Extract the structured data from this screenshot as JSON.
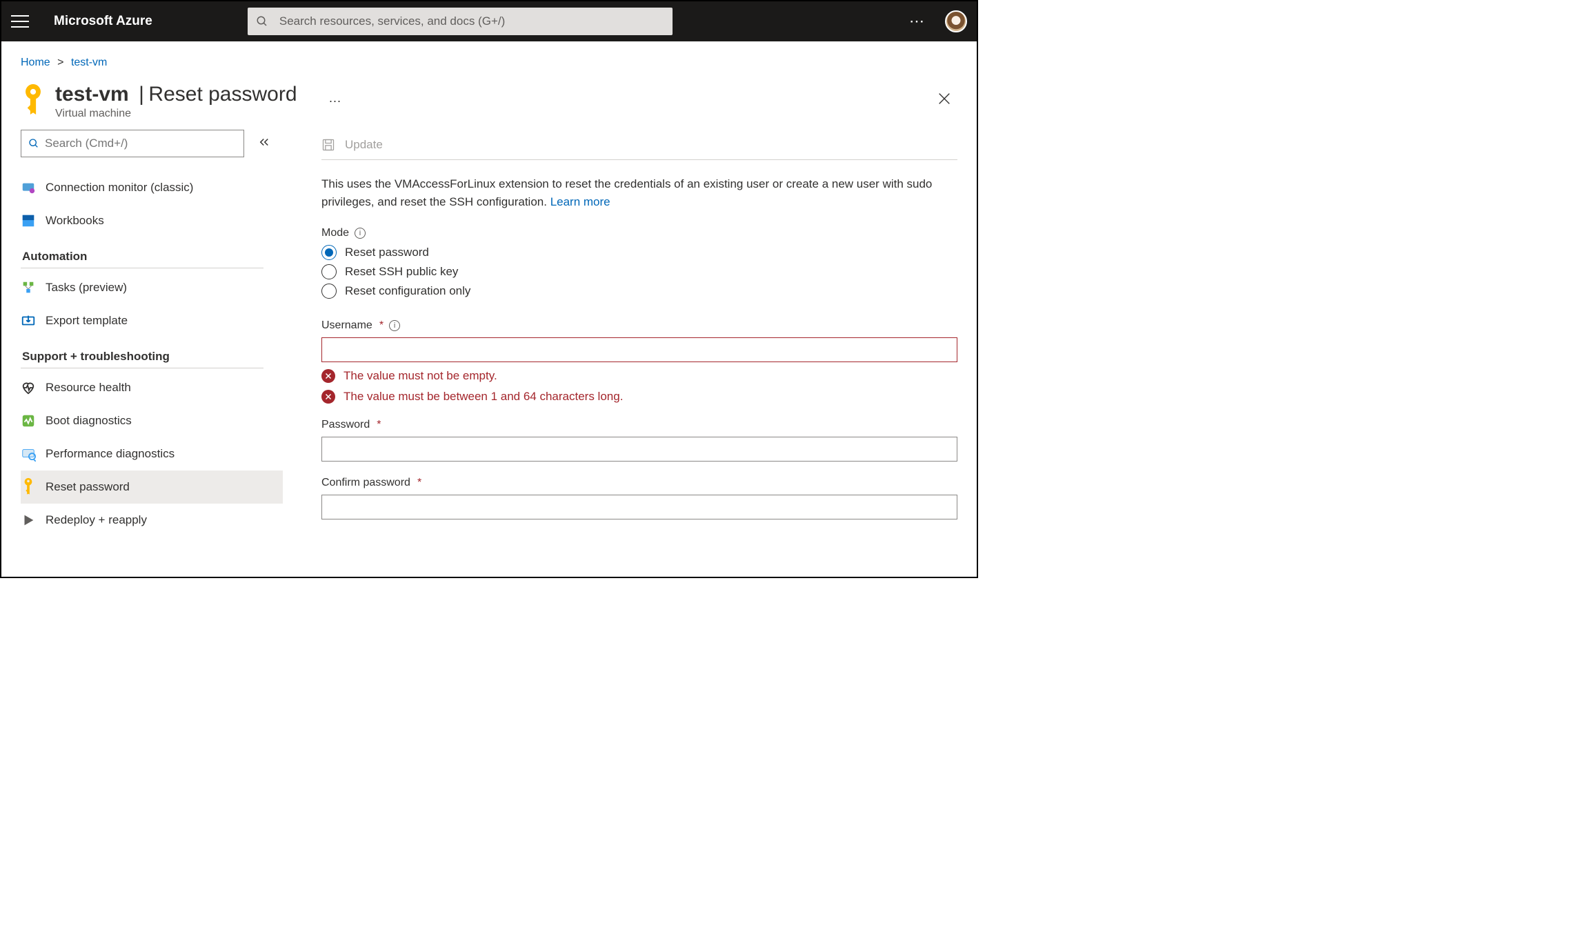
{
  "topbar": {
    "brand": "Microsoft Azure",
    "search_placeholder": "Search resources, services, and docs (G+/)"
  },
  "breadcrumb": {
    "home": "Home",
    "resource": "test-vm"
  },
  "page": {
    "resource_name": "test-vm",
    "section_title": "Reset password",
    "resource_type": "Virtual machine"
  },
  "sidebar": {
    "search_placeholder": "Search (Cmd+/)",
    "items_top": [
      {
        "label": "Connection monitor (classic)"
      },
      {
        "label": "Workbooks"
      }
    ],
    "section_automation": "Automation",
    "items_automation": [
      {
        "label": "Tasks (preview)"
      },
      {
        "label": "Export template"
      }
    ],
    "section_support": "Support + troubleshooting",
    "items_support": [
      {
        "label": "Resource health"
      },
      {
        "label": "Boot diagnostics"
      },
      {
        "label": "Performance diagnostics"
      },
      {
        "label": "Reset password",
        "active": true
      },
      {
        "label": "Redeploy + reapply"
      }
    ]
  },
  "toolbar": {
    "update": "Update"
  },
  "description": {
    "text": "This uses the VMAccessForLinux extension to reset the credentials of an existing user or create a new user with sudo privileges, and reset the SSH configuration. ",
    "learn_more": "Learn more"
  },
  "form": {
    "mode_label": "Mode",
    "mode_options": [
      "Reset password",
      "Reset SSH public key",
      "Reset configuration only"
    ],
    "mode_selected": 0,
    "username_label": "Username",
    "username_value": "",
    "username_errors": [
      "The value must not be empty.",
      "The value must be between 1 and 64 characters long."
    ],
    "password_label": "Password",
    "password_value": "",
    "confirm_label": "Confirm password",
    "confirm_value": ""
  }
}
